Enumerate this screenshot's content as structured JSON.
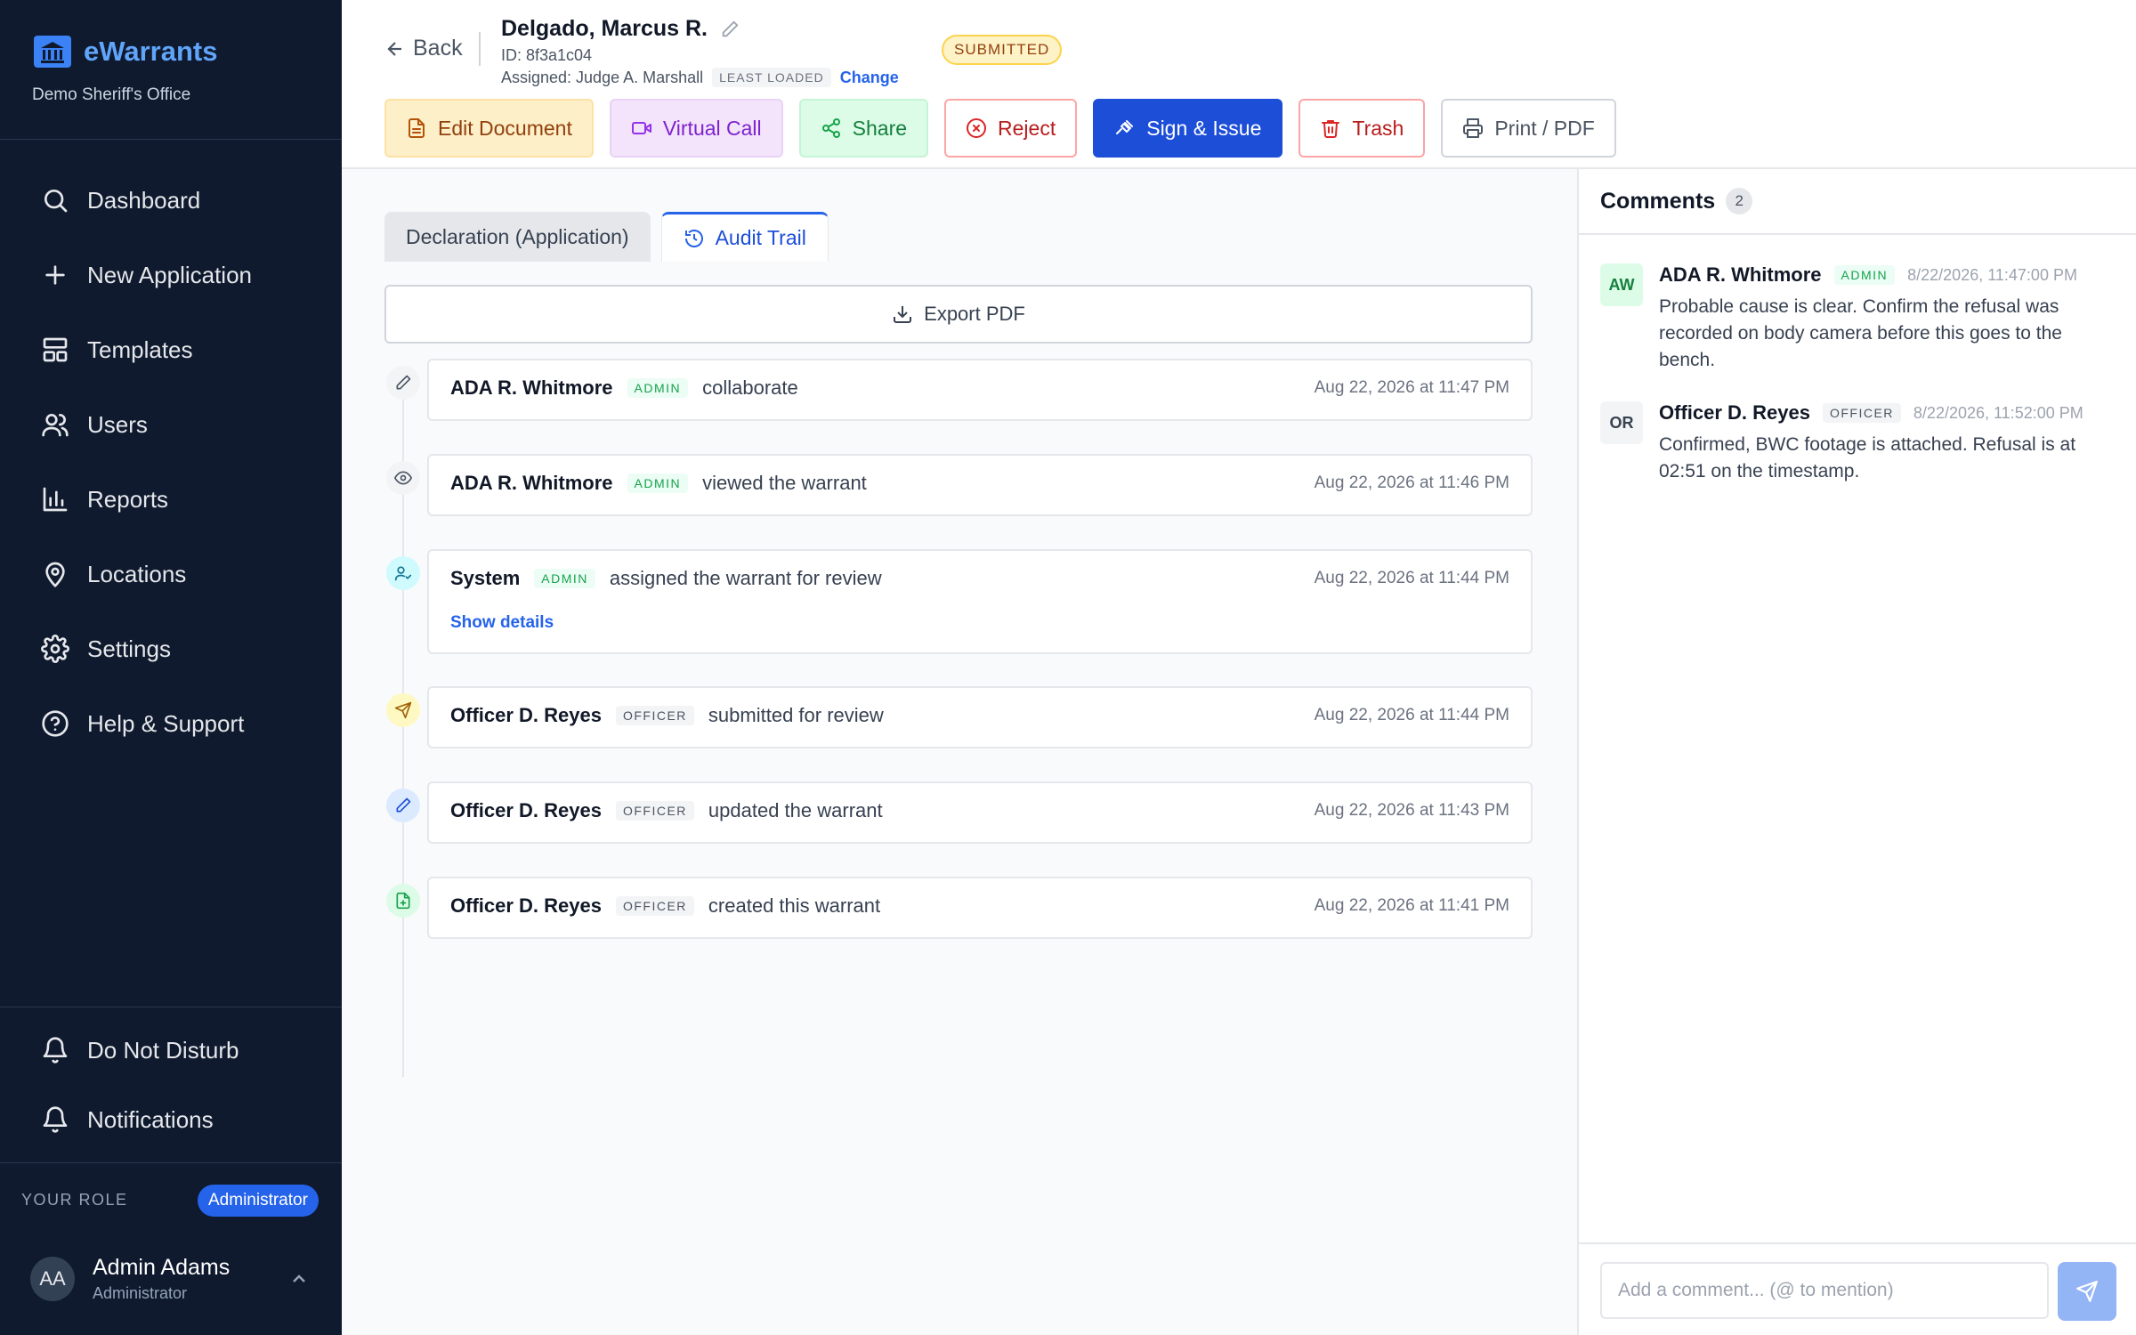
{
  "brand": {
    "name": "eWarrants",
    "subtitle": "Demo Sheriff's Office",
    "icon": "courthouse-icon"
  },
  "nav": [
    {
      "label": "Dashboard",
      "icon": "search-icon"
    },
    {
      "label": "New Application",
      "icon": "plus-icon"
    },
    {
      "label": "Templates",
      "icon": "layout-icon"
    },
    {
      "label": "Users",
      "icon": "users-icon"
    },
    {
      "label": "Reports",
      "icon": "bar-chart-icon"
    },
    {
      "label": "Locations",
      "icon": "map-pin-icon"
    },
    {
      "label": "Settings",
      "icon": "gear-icon"
    },
    {
      "label": "Help & Support",
      "icon": "help-circle-icon"
    }
  ],
  "sidebar_bottom": {
    "dnd_label": "Do Not Disturb",
    "notifications_label": "Notifications",
    "role_label": "YOUR ROLE",
    "role_value": "Administrator",
    "user": {
      "initials": "AA",
      "name": "Admin Adams",
      "role": "Administrator"
    }
  },
  "header": {
    "back_label": "Back",
    "title": "Delgado, Marcus R.",
    "id_text": "ID: 8f3a1c04",
    "assigned_text": "Assigned: Judge A. Marshall",
    "load_tag": "LEAST LOADED",
    "change_label": "Change",
    "status": "SUBMITTED"
  },
  "actions": {
    "edit": "Edit Document",
    "call": "Virtual Call",
    "share": "Share",
    "reject": "Reject",
    "sign": "Sign & Issue",
    "trash": "Trash",
    "print": "Print / PDF"
  },
  "tabs": {
    "declaration": "Declaration (Application)",
    "audit": "Audit Trail"
  },
  "export_label": "Export PDF",
  "events": [
    {
      "actor": "ADA R. Whitmore",
      "role": "ADMIN",
      "action": "collaborate",
      "time": "Aug 22, 2026 at 11:47 PM",
      "icon": "pencil-icon"
    },
    {
      "actor": "ADA R. Whitmore",
      "role": "ADMIN",
      "action": "viewed the warrant",
      "time": "Aug 22, 2026 at 11:46 PM",
      "icon": "eye-icon"
    },
    {
      "actor": "System",
      "role": "ADMIN",
      "action": "assigned the warrant for review",
      "time": "Aug 22, 2026 at 11:44 PM",
      "icon": "user-check-icon",
      "details_label": "Show details"
    },
    {
      "actor": "Officer D. Reyes",
      "role": "OFFICER",
      "action": "submitted for review",
      "time": "Aug 22, 2026 at 11:44 PM",
      "icon": "send-icon"
    },
    {
      "actor": "Officer D. Reyes",
      "role": "OFFICER",
      "action": "updated the warrant",
      "time": "Aug 22, 2026 at 11:43 PM",
      "icon": "pencil-icon"
    },
    {
      "actor": "Officer D. Reyes",
      "role": "OFFICER",
      "action": "created this warrant",
      "time": "Aug 22, 2026 at 11:41 PM",
      "icon": "file-plus-icon"
    }
  ],
  "comments": {
    "title": "Comments",
    "count": "2",
    "items": [
      {
        "initials": "AW",
        "name": "ADA R. Whitmore",
        "role": "ADMIN",
        "time": "8/22/2026, 11:47:00 PM",
        "text": "Probable cause is clear. Confirm the refusal was recorded on body camera before this goes to the bench."
      },
      {
        "initials": "OR",
        "name": "Officer D. Reyes",
        "role": "OFFICER",
        "time": "8/22/2026, 11:52:00 PM",
        "text": "Confirmed, BWC footage is attached. Refusal is at 02:51 on the timestamp."
      }
    ],
    "placeholder": "Add a comment... (@ to mention)"
  },
  "colors": {
    "sidebar_bg": "#0f1a2e",
    "accent": "#2563eb",
    "brand": "#60a5fa",
    "status_bg": "#fef3c7"
  }
}
